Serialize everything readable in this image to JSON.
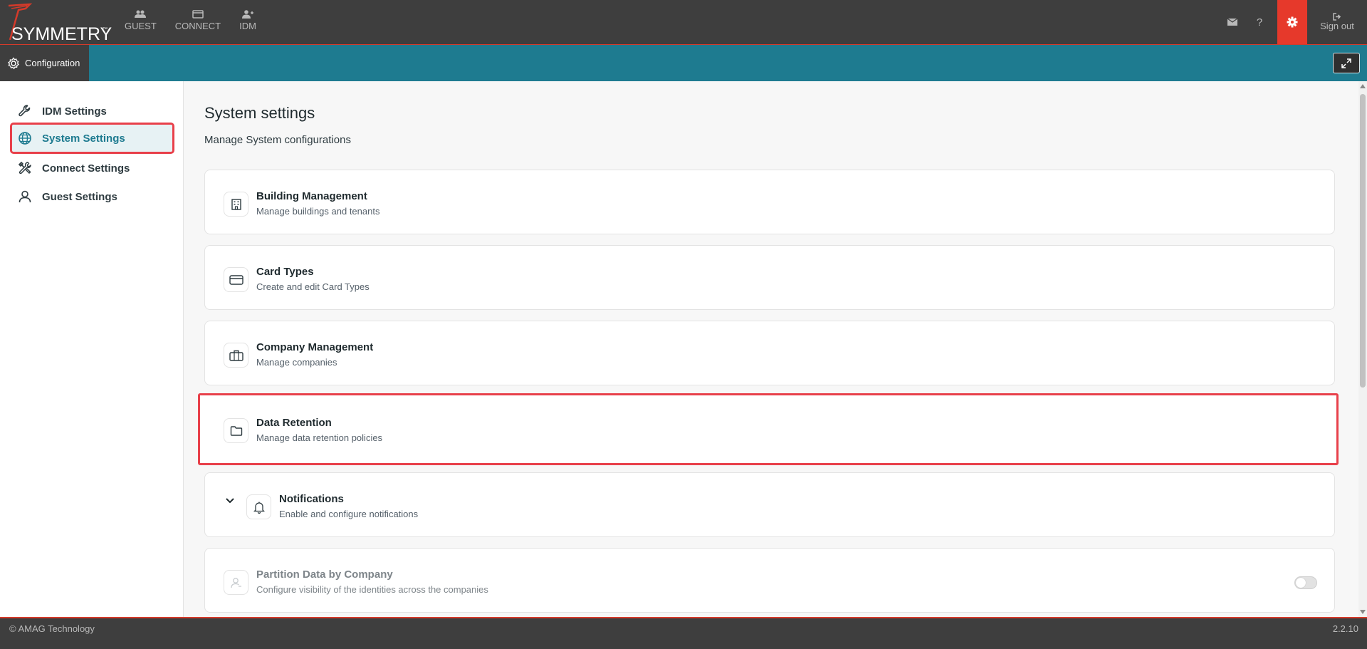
{
  "brand": {
    "name": "SYMMETRY",
    "tm": "™"
  },
  "topnav": [
    {
      "label": "GUEST",
      "icon": "users-icon"
    },
    {
      "label": "CONNECT",
      "icon": "card-icon"
    },
    {
      "label": "IDM",
      "icon": "user-plus-icon"
    }
  ],
  "topright": {
    "mail_icon": "envelope-icon",
    "help": "?",
    "settings_icon": "gear-icon",
    "signout_label": "Sign out"
  },
  "subbar": {
    "tab_label": "Configuration"
  },
  "sidebar": {
    "items": [
      {
        "label": "IDM Settings",
        "icon": "wrench-icon",
        "active": false
      },
      {
        "label": "System Settings",
        "icon": "globe-icon",
        "active": true
      },
      {
        "label": "Connect Settings",
        "icon": "tools-icon",
        "active": false
      },
      {
        "label": "Guest Settings",
        "icon": "user-icon",
        "active": false
      }
    ]
  },
  "main": {
    "title": "System settings",
    "subtitle": "Manage System configurations",
    "cards": [
      {
        "title": "Building Management",
        "desc": "Manage buildings and tenants",
        "icon": "building-icon"
      },
      {
        "title": "Card Types",
        "desc": "Create and edit Card Types",
        "icon": "credit-card-icon"
      },
      {
        "title": "Company Management",
        "desc": "Manage companies",
        "icon": "briefcase-icon"
      },
      {
        "title": "Data Retention",
        "desc": "Manage data retention policies",
        "icon": "folder-icon"
      },
      {
        "title": "Notifications",
        "desc": "Enable and configure notifications",
        "icon": "bell-icon"
      },
      {
        "title": "Partition Data by Company",
        "desc": "Configure visibility of the identities across the companies",
        "icon": "user-slash-icon",
        "toggle_on": false
      }
    ]
  },
  "footer": {
    "copyright": "© AMAG Technology",
    "version": "2.2.10"
  },
  "colors": {
    "accent": "#1e7b90",
    "brand_red": "#e6392b",
    "highlight": "#e8404a",
    "dark": "#3e3e3e"
  }
}
